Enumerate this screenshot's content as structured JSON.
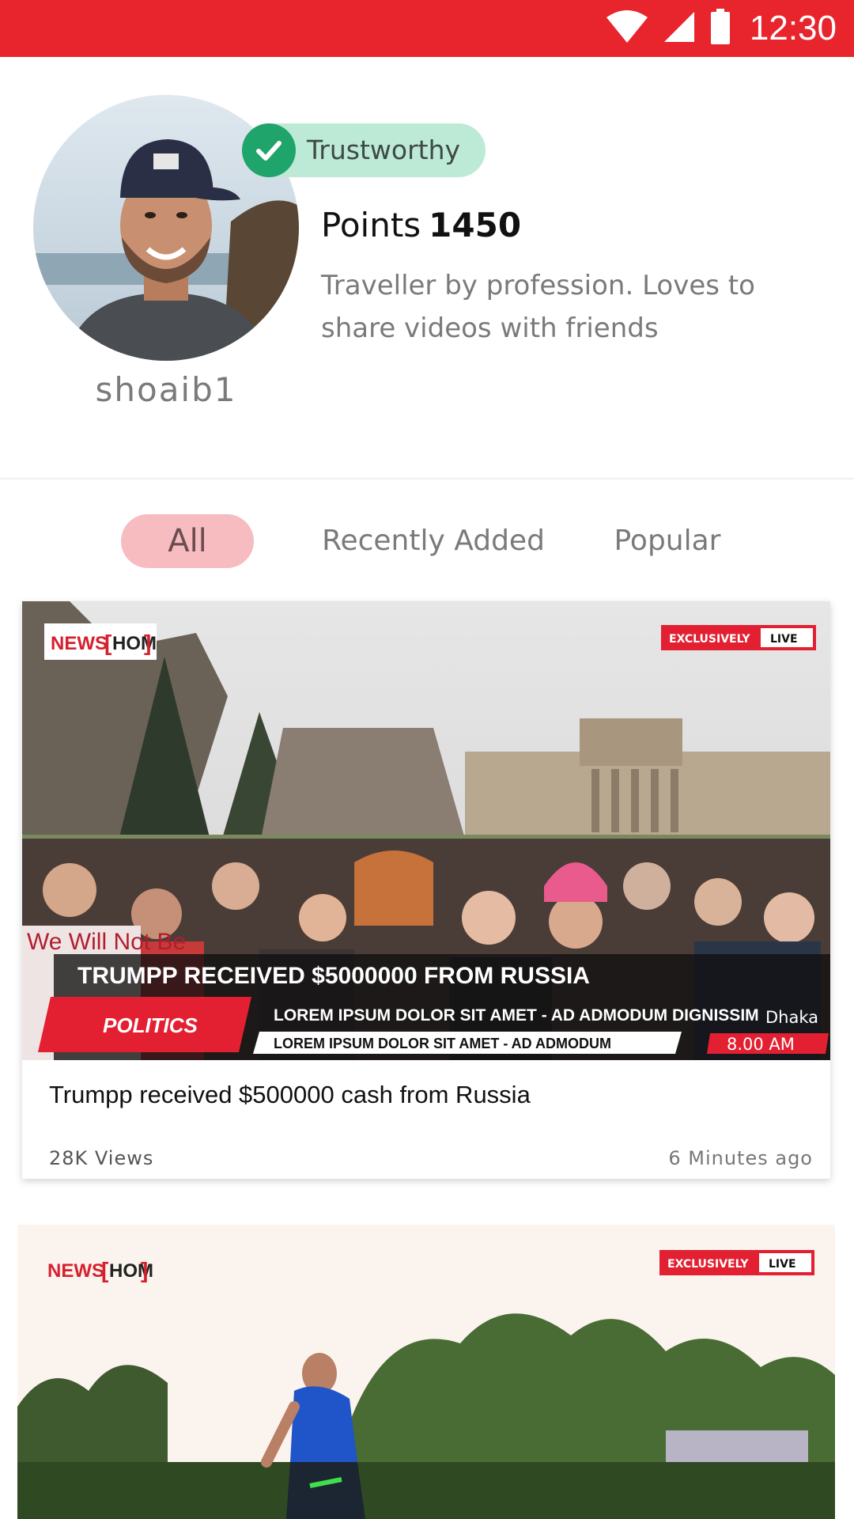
{
  "theme": {
    "accent": "#e8242d",
    "badge_bg": "#bde9d7",
    "badge_check": "#1fa46b",
    "tab_active_bg": "#f6bcc0"
  },
  "status_bar": {
    "time": "12:30",
    "icons": [
      "wifi-icon",
      "cell-signal-icon",
      "battery-icon"
    ]
  },
  "profile": {
    "username": "shoaib1",
    "badge": "Trustworthy",
    "points_label": "Points",
    "points_value": "1450",
    "bio": "Traveller by profession. Loves to share videos with friends"
  },
  "tabs": [
    {
      "label": "All",
      "active": true
    },
    {
      "label": "Recently Added",
      "active": false
    },
    {
      "label": "Popular",
      "active": false
    }
  ],
  "videos": [
    {
      "overlay": {
        "logo_left": "NEWS",
        "logo_right": "HOM",
        "live_left": "EXCLUSIVELY",
        "live_right": "LIVE",
        "headline": "TRUMPP RECEIVED $5000000 FROM RUSSIA",
        "category": "POLITICS",
        "ticker_1": "LOREM IPSUM DOLOR SIT AMET - AD ADMODUM DIGNISSIM",
        "ticker_2": "LOREM IPSUM DOLOR SIT AMET - AD ADMODUM",
        "location": "Dhaka",
        "time": "8.00 AM",
        "sign_text": "We Will Not Be"
      },
      "title": "Trumpp received $500000 cash from Russia",
      "views": "28K Views",
      "posted": "6 Minutes ago"
    },
    {
      "overlay": {
        "logo_left": "NEWS",
        "logo_right": "HOM",
        "live_left": "EXCLUSIVELY",
        "live_right": "LIVE"
      }
    }
  ]
}
